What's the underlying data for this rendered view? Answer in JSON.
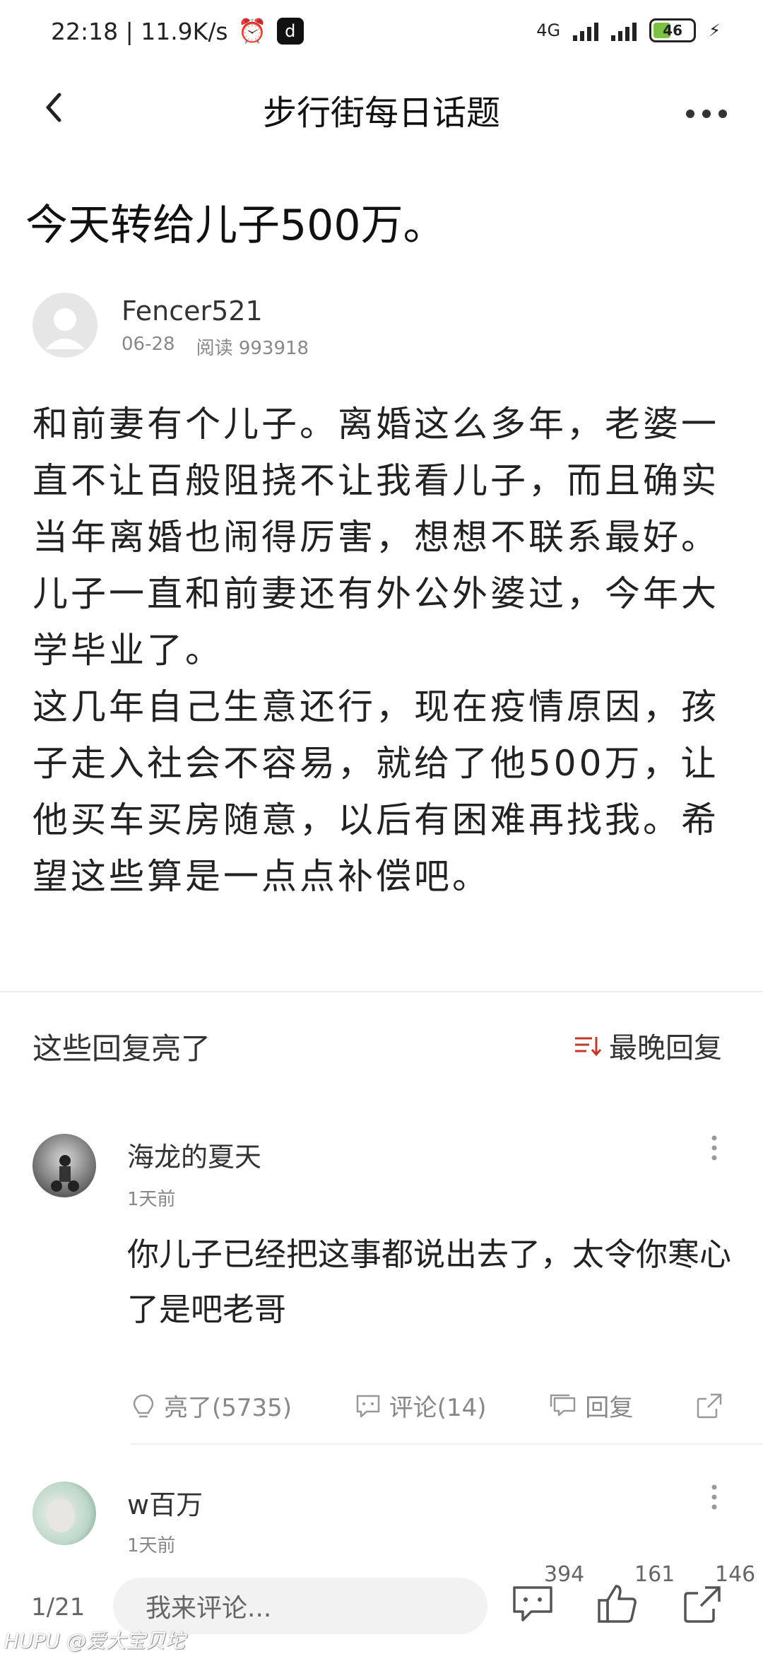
{
  "status": {
    "time_speed": "22:18 | 11.9K/s",
    "app_badge": "d",
    "network": "4G",
    "battery": "46"
  },
  "header": {
    "title": "步行街每日话题"
  },
  "post": {
    "title": "今天转给儿子500万。",
    "author": "Fencer521",
    "date": "06-28",
    "reads": "阅读 993918",
    "paragraphs": [
      "和前妻有个儿子。离婚这么多年，老婆一直不让百般阻挠不让我看儿子，而且确实当年离婚也闹得厉害，想想不联系最好。",
      "儿子一直和前妻还有外公外婆过，今年大学毕业了。",
      "这几年自己生意还行，现在疫情原因，孩子走入社会不容易，就给了他500万，让他买车买房随意，以后有困难再找我。希望这些算是一点点补偿吧。"
    ]
  },
  "section": {
    "title": "这些回复亮了",
    "sort_label": "最晚回复"
  },
  "comments": [
    {
      "name": "海龙的夏天",
      "time": "1天前",
      "text": "你儿子已经把这事都说出去了，太令你寒心了是吧老哥",
      "light": "亮了(5735)",
      "comment": "评论(14)",
      "reply": "回复"
    },
    {
      "name": "w百万",
      "time": "1天前"
    }
  ],
  "bottom": {
    "pager": "1/21",
    "placeholder": "我来评论...",
    "comments_count": "394",
    "likes_count": "161",
    "shares_count": "146"
  },
  "watermark": "HUPU @爱大宝贝坨"
}
